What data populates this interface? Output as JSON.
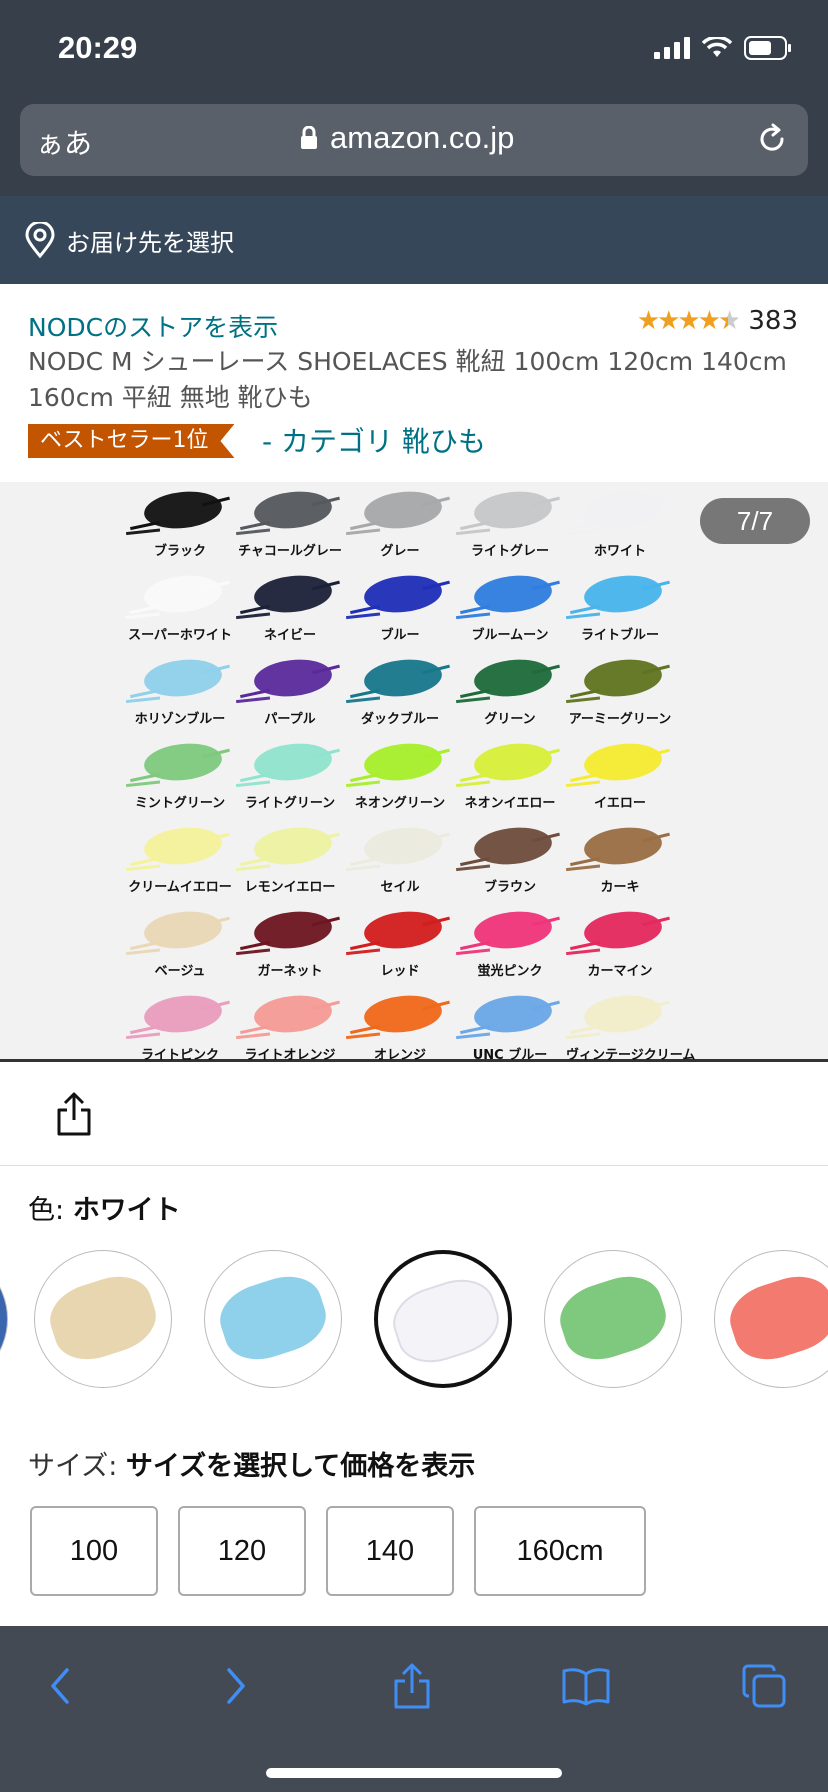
{
  "status": {
    "time": "20:29"
  },
  "browser": {
    "text_size_label": "ぁあ",
    "domain": "amazon.co.jp"
  },
  "delivery": {
    "label": "お届け先を選択"
  },
  "product": {
    "store_link": "NODCのストアを表示",
    "rating_value": 4.5,
    "rating_count": "383",
    "title": "NODC M シューレース SHOELACES 靴紐 100cm 120cm 140cm 160cm 平紐 無地 靴ひも",
    "bestseller_badge": "ベストセラー1位",
    "category_link": "- カテゴリ 靴ひも"
  },
  "gallery": {
    "counter": "7/7",
    "swatches": [
      {
        "label": "ブラック",
        "color": "#111111"
      },
      {
        "label": "チャコールグレー",
        "color": "#55585c"
      },
      {
        "label": "グレー",
        "color": "#a7a8aa"
      },
      {
        "label": "ライトグレー",
        "color": "#c6c7c9"
      },
      {
        "label": "ホワイト",
        "color": "#f1f1f4"
      },
      {
        "label": "スーパーホワイト",
        "color": "#fafafa"
      },
      {
        "label": "ネイビー",
        "color": "#1d2138"
      },
      {
        "label": "ブルー",
        "color": "#1f2fb8"
      },
      {
        "label": "ブルームーン",
        "color": "#2f7de0"
      },
      {
        "label": "ライトブルー",
        "color": "#48b4ec"
      },
      {
        "label": "ホリゾンブルー",
        "color": "#8fd0ea"
      },
      {
        "label": "パープル",
        "color": "#5a2a9c"
      },
      {
        "label": "ダックブルー",
        "color": "#17778c"
      },
      {
        "label": "グリーン",
        "color": "#1d6b3a"
      },
      {
        "label": "アーミーグリーン",
        "color": "#5f7420"
      },
      {
        "label": "ミントグリーン",
        "color": "#7fc97e"
      },
      {
        "label": "ライトグリーン",
        "color": "#8fe4cf"
      },
      {
        "label": "ネオングリーン",
        "color": "#a8ef2a"
      },
      {
        "label": "ネオンイエロー",
        "color": "#d8f03a"
      },
      {
        "label": "イエロー",
        "color": "#f5ec30"
      },
      {
        "label": "クリームイエロー",
        "color": "#f5f29a"
      },
      {
        "label": "レモンイエロー",
        "color": "#eef3a0"
      },
      {
        "label": "セイル",
        "color": "#ecebde"
      },
      {
        "label": "ブラウン",
        "color": "#6e4d3c"
      },
      {
        "label": "カーキ",
        "color": "#9a6e45"
      },
      {
        "label": "ベージュ",
        "color": "#ead8b5"
      },
      {
        "label": "ガーネット",
        "color": "#6d1520"
      },
      {
        "label": "レッド",
        "color": "#d21d1e"
      },
      {
        "label": "蛍光ピンク",
        "color": "#f0347a"
      },
      {
        "label": "カーマイン",
        "color": "#e5285e"
      },
      {
        "label": "ライトピンク",
        "color": "#ea9dbe"
      },
      {
        "label": "ライトオレンジ",
        "color": "#f59b96"
      },
      {
        "label": "オレンジ",
        "color": "#f0691b"
      },
      {
        "label": "UNC ブルー",
        "color": "#6aa8e8"
      },
      {
        "label": "ヴィンテージクリーム",
        "color": "#f2eec9"
      }
    ]
  },
  "color_selector": {
    "prefix": "色: ",
    "selected": "ホワイト",
    "options": [
      {
        "name": "beige",
        "color": "#e8d6b0"
      },
      {
        "name": "horizon-blue",
        "color": "#8fd0ea"
      },
      {
        "name": "white",
        "color": "#f4f4f8"
      },
      {
        "name": "mint-green",
        "color": "#7fc97e"
      },
      {
        "name": "light-orange",
        "color": "#f27a6e"
      }
    ]
  },
  "size_selector": {
    "prefix": "サイズ: ",
    "prompt": "サイズを選択して価格を表示",
    "options": [
      "100",
      "120",
      "140",
      "160cm"
    ]
  },
  "colors": {
    "link": "#007185",
    "badge": "#c45500",
    "toolbar_icon": "#3f8ef5"
  }
}
